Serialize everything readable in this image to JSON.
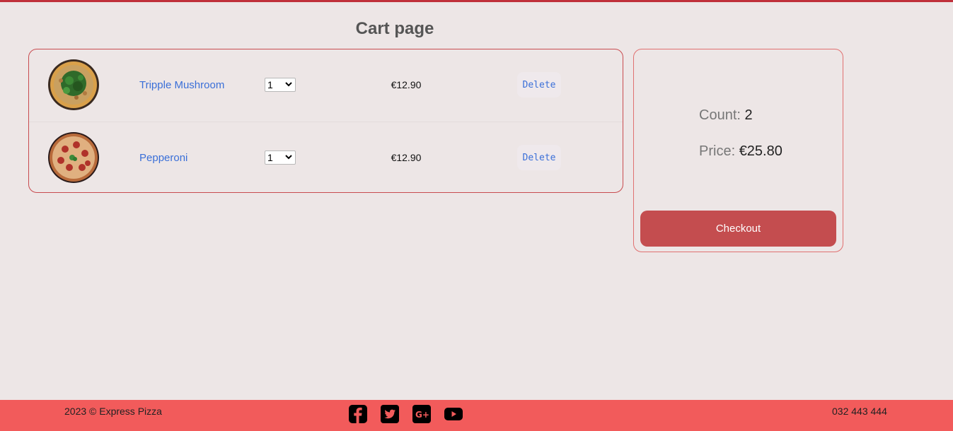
{
  "page": {
    "title": "Cart page"
  },
  "cart": {
    "items": [
      {
        "name": "Tripple Mushroom",
        "quantity": "1",
        "price": "€12.90",
        "delete_label": "Delete"
      },
      {
        "name": "Pepperoni",
        "quantity": "1",
        "price": "€12.90",
        "delete_label": "Delete"
      }
    ]
  },
  "summary": {
    "count_label": "Count:",
    "count_value": "2",
    "price_label": "Price:",
    "price_value": "€25.80",
    "checkout_label": "Checkout"
  },
  "footer": {
    "copyright": "2023 © Express Pizza",
    "phone": "032 443 444",
    "social_icons": [
      "facebook-icon",
      "twitter-icon",
      "google-plus-icon",
      "youtube-icon"
    ]
  },
  "colors": {
    "background": "#ede6e6",
    "accent": "#c44d4f",
    "footer": "#f25b5b",
    "link": "#3a6fd8"
  }
}
